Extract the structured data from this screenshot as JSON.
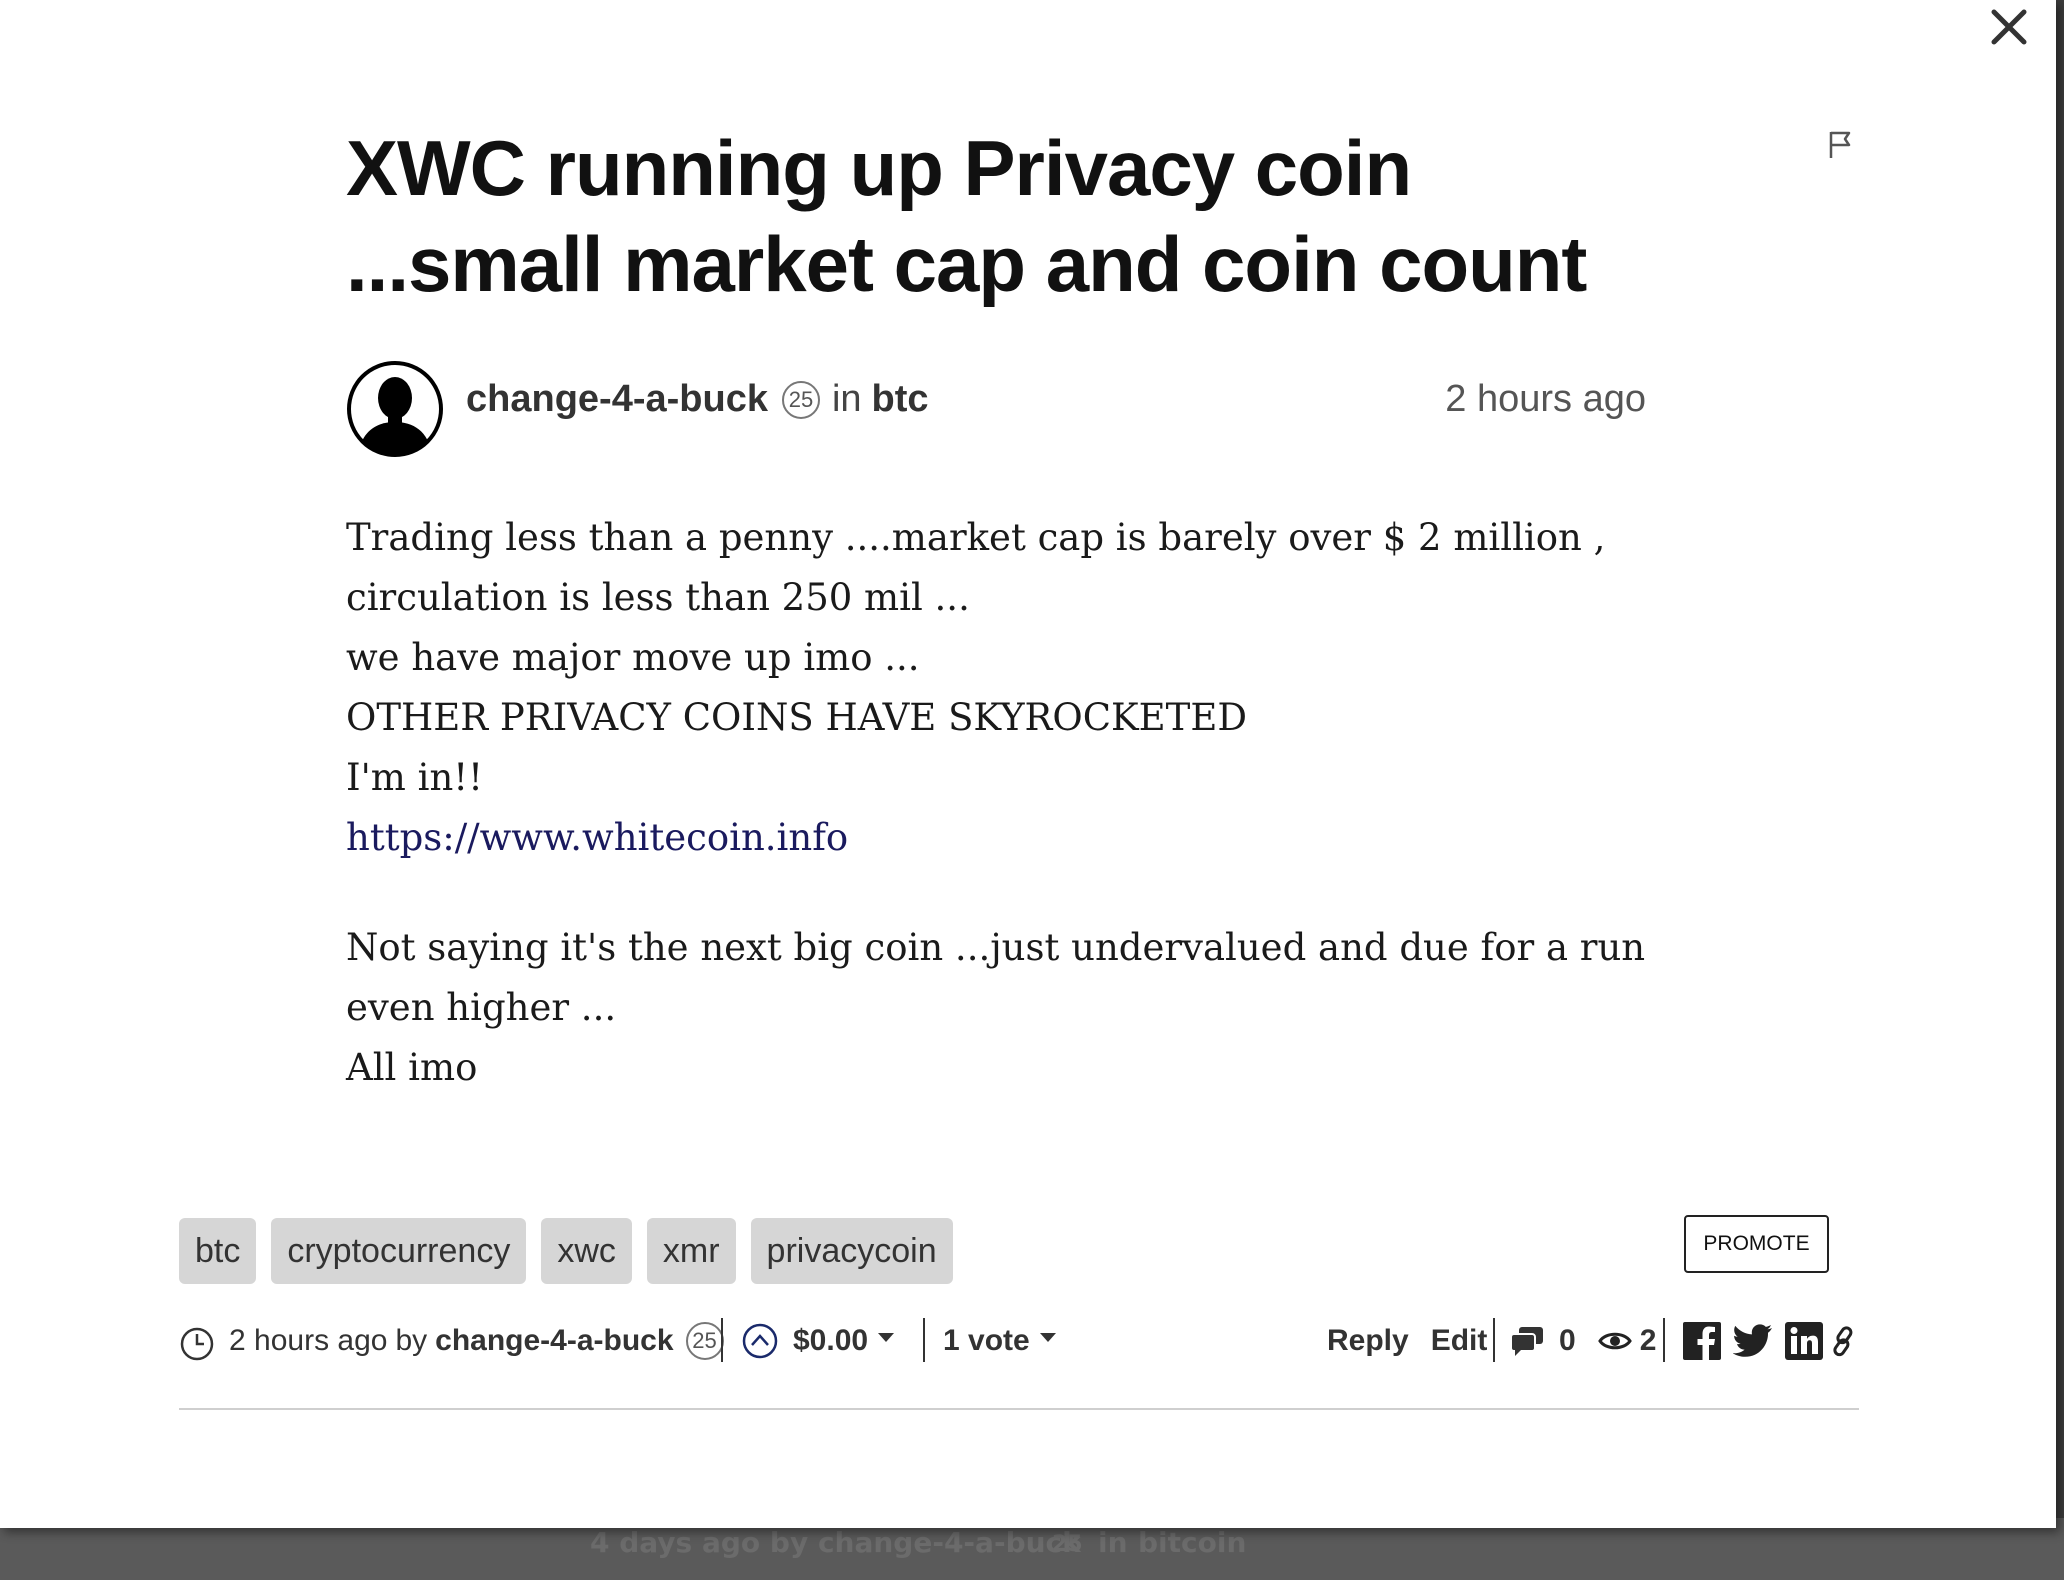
{
  "background": {
    "text": "4 days ago by change-4-a-buck",
    "badge": "25",
    "in": "in",
    "category": "bitcoin"
  },
  "post": {
    "title": "XWC running up Privacy coin ...small market cap and coin count",
    "author": "change-4-a-buck",
    "author_rep": "25",
    "in_label": "in",
    "category": "btc",
    "time": "2 hours ago",
    "body": {
      "p1_lines": [
        "Trading less than a penny ....market cap is barely over $ 2 million ,",
        "circulation is less than 250 mil ...",
        "we have major move up imo ...",
        "OTHER PRIVACY COINS HAVE SKYROCKETED",
        "I'm in!!"
      ],
      "link": "https://www.whitecoin.info",
      "p2_line1": "Not saying it's the next big coin ...just undervalued and due for a run even higher ...",
      "p2_line2": "All imo"
    },
    "tags": [
      "btc",
      "cryptocurrency",
      "xwc",
      "xmr",
      "privacycoin"
    ],
    "promote_label": "PROMOTE"
  },
  "footer": {
    "time": "2 hours ago",
    "by": "by",
    "author": "change-4-a-buck",
    "author_rep": "25",
    "payout": "$0.00",
    "votes": "1 vote",
    "reply": "Reply",
    "edit": "Edit",
    "comments": "0",
    "views": "2"
  },
  "icons": {
    "close": "close-icon",
    "flag": "flag-icon",
    "clock": "clock-icon",
    "upvote": "upvote-icon",
    "comments": "comments-icon",
    "views": "eye-icon",
    "facebook": "facebook-icon",
    "twitter": "twitter-icon",
    "linkedin": "linkedin-icon",
    "link": "link-icon"
  }
}
